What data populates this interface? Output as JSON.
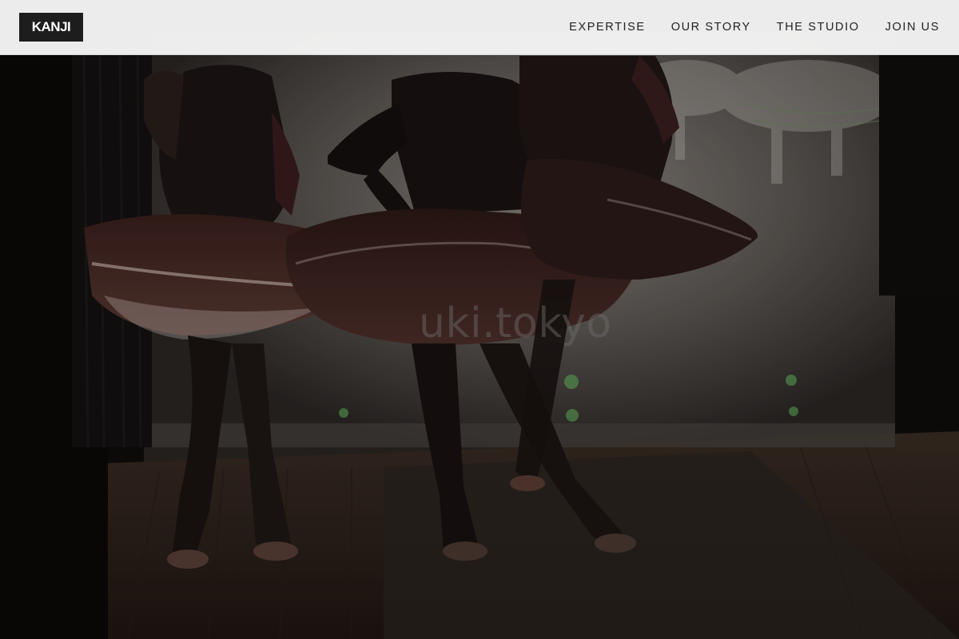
{
  "brand": {
    "logo_text": "KANJI"
  },
  "nav": {
    "items": [
      {
        "id": "expertise",
        "label": "EXPERTISE"
      },
      {
        "id": "our-story",
        "label": "OUR STORY"
      },
      {
        "id": "the-studio",
        "label": "THE STUDIO"
      },
      {
        "id": "join-us",
        "label": "JOIN US"
      }
    ]
  },
  "hero": {
    "watermark_text": "uki.tokyo"
  },
  "colors": {
    "header_bg": "#f6f6f6",
    "logo_bg": "#1d1d1d",
    "nav_text": "#222222"
  }
}
